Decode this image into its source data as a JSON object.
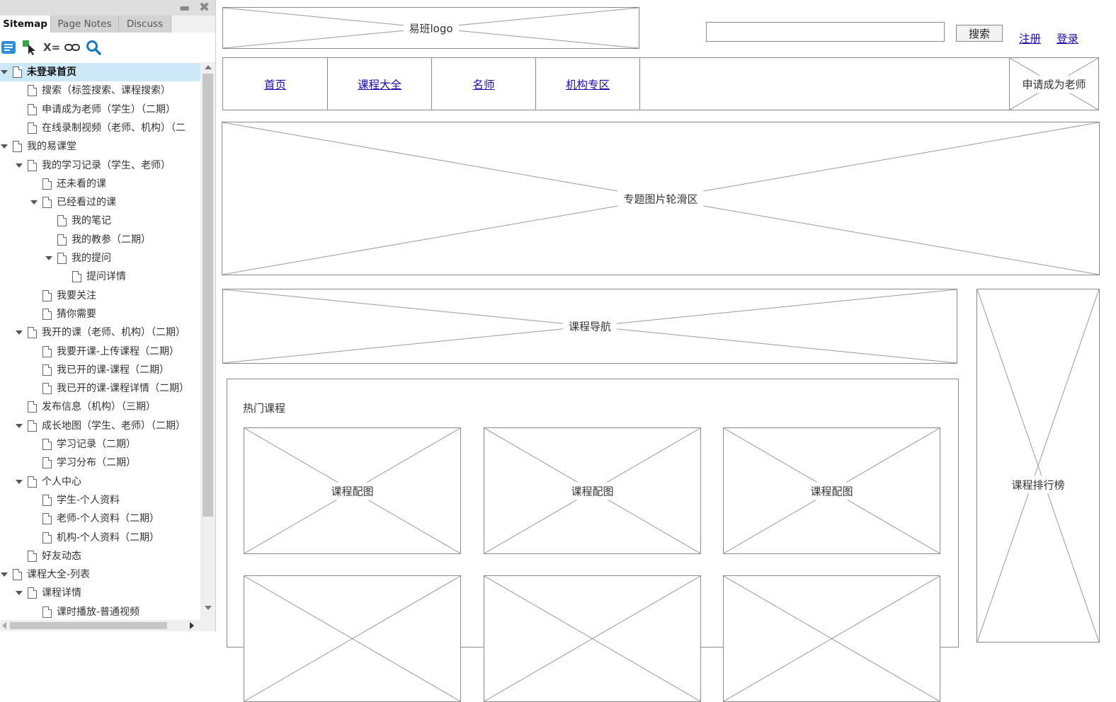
{
  "pane": {
    "tabs": [
      {
        "label": "Sitemap",
        "active": true
      },
      {
        "label": "Page Notes",
        "active": false
      },
      {
        "label": "Discuss",
        "active": false
      }
    ],
    "toolbar": {
      "variables_label": "X="
    },
    "tree": [
      {
        "label": "未登录首页",
        "level": 0,
        "expanded": true,
        "selected": true
      },
      {
        "label": "搜索（标签搜索、课程搜索）",
        "level": 1
      },
      {
        "label": "申请成为老师（学生）（二期）",
        "level": 1
      },
      {
        "label": "在线录制视频（老师、机构）（二",
        "level": 1
      },
      {
        "label": "我的易课堂",
        "level": 0,
        "expanded": true
      },
      {
        "label": "我的学习记录（学生、老师）",
        "level": 1,
        "expanded": true
      },
      {
        "label": "还未看的课",
        "level": 2
      },
      {
        "label": "已经看过的课",
        "level": 2,
        "expanded": true
      },
      {
        "label": "我的笔记",
        "level": 3
      },
      {
        "label": "我的教参（二期）",
        "level": 3
      },
      {
        "label": "我的提问",
        "level": 3,
        "expanded": true
      },
      {
        "label": "提问详情",
        "level": 4
      },
      {
        "label": "我要关注",
        "level": 2
      },
      {
        "label": "猜你需要",
        "level": 2
      },
      {
        "label": "我开的课（老师、机构）（二期）",
        "level": 1,
        "expanded": true
      },
      {
        "label": "我要开课-上传课程（二期）",
        "level": 2
      },
      {
        "label": "我已开的课-课程（二期）",
        "level": 2
      },
      {
        "label": "我已开的课-课程详情（二期）",
        "level": 2
      },
      {
        "label": "发布信息（机构）（三期）",
        "level": 1
      },
      {
        "label": "成长地图（学生、老师）（二期）",
        "level": 1,
        "expanded": true
      },
      {
        "label": "学习记录（二期）",
        "level": 2
      },
      {
        "label": "学习分布（二期）",
        "level": 2
      },
      {
        "label": "个人中心",
        "level": 1,
        "expanded": true
      },
      {
        "label": "学生-个人资料",
        "level": 2
      },
      {
        "label": "老师-个人资料（二期）",
        "level": 2
      },
      {
        "label": "机构-个人资料（二期）",
        "level": 2
      },
      {
        "label": "好友动态",
        "level": 1
      },
      {
        "label": "课程大全-列表",
        "level": 0,
        "expanded": true
      },
      {
        "label": "课程详情",
        "level": 1,
        "expanded": true
      },
      {
        "label": "课时播放-普通视频",
        "level": 2
      }
    ]
  },
  "header": {
    "logo": "易班logo",
    "search_placeholder": "",
    "search_button": "搜索",
    "register": "注册",
    "login": "登录"
  },
  "nav": {
    "items": [
      "首页",
      "课程大全",
      "名师",
      "机构专区"
    ],
    "apply_teacher": "申请成为老师"
  },
  "banner": "专题图片轮滑区",
  "course_nav": "课程导航",
  "ranking": "课程排行榜",
  "hot": {
    "title": "热门课程",
    "cards": [
      "课程配图",
      "课程配图",
      "课程配图",
      "",
      "",
      ""
    ]
  },
  "colors": {
    "link": "#1a0dab",
    "selected_row": "#cde8f6",
    "wireframe_stroke": "#8a8a8a"
  }
}
